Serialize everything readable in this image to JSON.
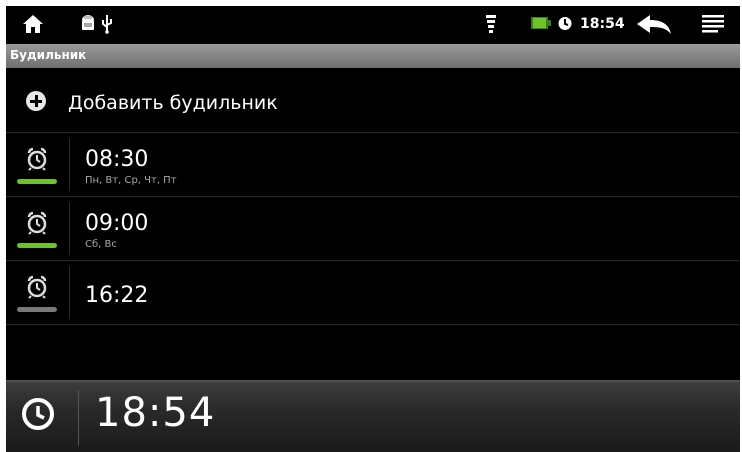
{
  "status_bar": {
    "time": "18:54",
    "icons": [
      "home-icon",
      "android-debug-icon",
      "usb-icon",
      "wifi-icon",
      "battery-icon",
      "alarm-status-icon",
      "back-icon",
      "menu-icon"
    ],
    "battery_color": "#6dc42a"
  },
  "title_bar": {
    "title": "Будильник"
  },
  "add_alarm": {
    "label": "Добавить будильник"
  },
  "alarms": [
    {
      "time": "08:30",
      "days": "Пн, Вт, Ср, Чт, Пт",
      "enabled": true
    },
    {
      "time": "09:00",
      "days": "Сб, Вс",
      "enabled": true
    },
    {
      "time": "16:22",
      "days": "",
      "enabled": false
    }
  ],
  "colors": {
    "enabled": "#6dc42a",
    "disabled": "#7a7a7a"
  },
  "clock": {
    "time": "18:54"
  }
}
